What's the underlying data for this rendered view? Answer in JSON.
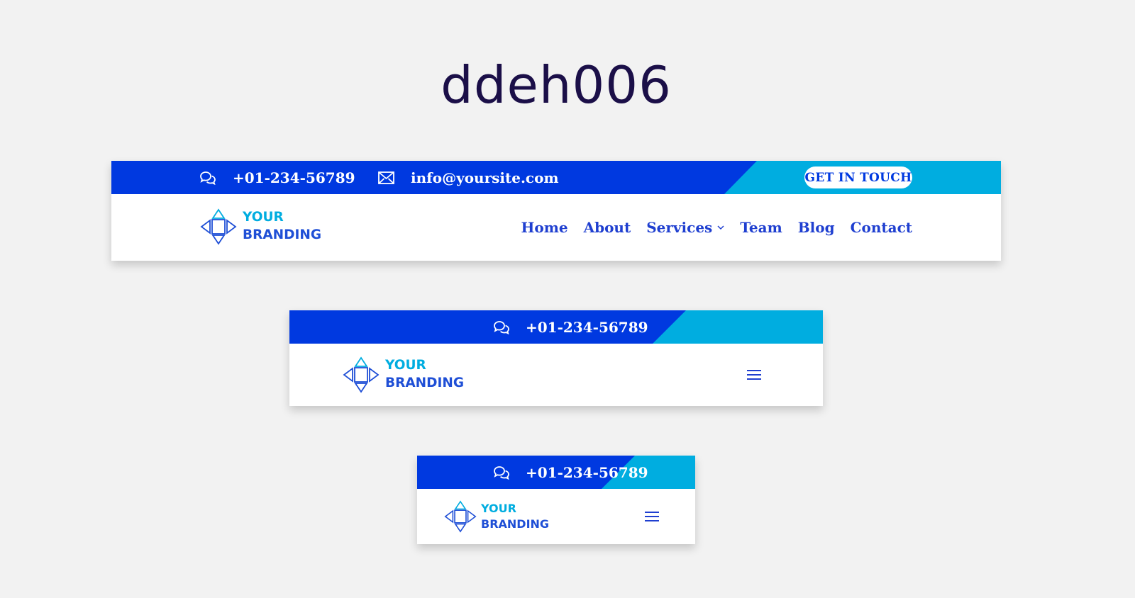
{
  "page_title": "ddeh006",
  "colors": {
    "primary_blue": "#0039e0",
    "accent_cyan": "#00ade0",
    "nav_text": "#1f3fd0",
    "title_text": "#1b0f48",
    "background": "#f2f2f2"
  },
  "desktop_header": {
    "phone_icon": "chat-bubbles-icon",
    "phone": "+01-234-56789",
    "email_icon": "envelope-icon",
    "email": "info@yoursite.com",
    "cta_label": "GET IN TOUCH",
    "logo": {
      "line1": "YOUR",
      "line2": "BRANDING"
    },
    "nav": [
      {
        "label": "Home"
      },
      {
        "label": "About"
      },
      {
        "label": "Services",
        "has_dropdown": true
      },
      {
        "label": "Team"
      },
      {
        "label": "Blog"
      },
      {
        "label": "Contact"
      }
    ]
  },
  "tablet_header": {
    "phone_icon": "chat-bubbles-icon",
    "phone": "+01-234-56789",
    "logo": {
      "line1": "YOUR",
      "line2": "BRANDING"
    },
    "menu_icon": "hamburger-icon"
  },
  "mobile_header": {
    "phone_icon": "chat-bubbles-icon",
    "phone": "+01-234-56789",
    "logo": {
      "line1": "YOUR",
      "line2": "BRANDING"
    },
    "menu_icon": "hamburger-icon"
  }
}
